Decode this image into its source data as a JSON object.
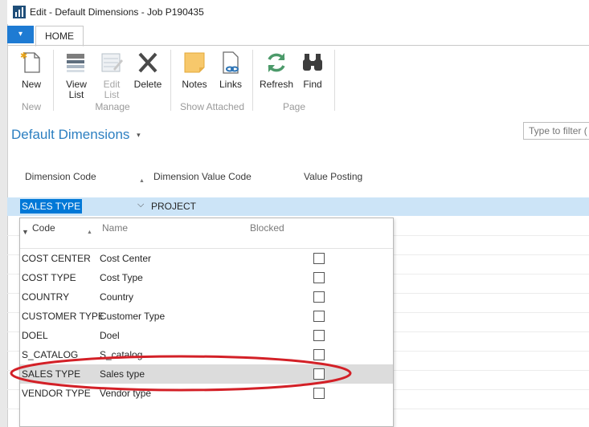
{
  "window": {
    "title": "Edit - Default Dimensions - Job P190435"
  },
  "ribbon": {
    "file_glyph": "▾",
    "tab_home": "HOME",
    "buttons": {
      "new": "New",
      "view_list_1": "View",
      "view_list_2": "List",
      "edit_list_1": "Edit",
      "edit_list_2": "List",
      "delete": "Delete",
      "notes": "Notes",
      "links": "Links",
      "refresh": "Refresh",
      "find": "Find"
    },
    "groups": {
      "new": "New",
      "manage": "Manage",
      "show_attached": "Show Attached",
      "page": "Page"
    }
  },
  "page": {
    "title": "Default Dimensions",
    "title_caret": "▾",
    "filter_placeholder": "Type to filter (",
    "columns": [
      "Dimension Code",
      "Dimension Value Code",
      "Value Posting"
    ]
  },
  "selected_row": {
    "dimension_code": "SALES TYPE",
    "dimension_value_code": "PROJECT"
  },
  "dropdown": {
    "headers": {
      "code": "Code",
      "name": "Name",
      "blocked": "Blocked"
    },
    "rows": [
      {
        "code": "COST CENTER",
        "name": "Cost Center",
        "blocked": false
      },
      {
        "code": "COST TYPE",
        "name": "Cost Type",
        "blocked": false
      },
      {
        "code": "COUNTRY",
        "name": "Country",
        "blocked": false
      },
      {
        "code": "CUSTOMER TYPE",
        "name": "Customer Type",
        "blocked": false
      },
      {
        "code": "DOEL",
        "name": "Doel",
        "blocked": false
      },
      {
        "code": "S_CATALOG",
        "name": "S_catalog",
        "blocked": false
      },
      {
        "code": "SALES TYPE",
        "name": "Sales type",
        "blocked": false,
        "highlighted": true
      },
      {
        "code": "VENDOR TYPE",
        "name": "Vendor type",
        "blocked": false
      }
    ]
  },
  "colors": {
    "accent": "#2c7fc1",
    "selection": "#0078d7",
    "row_highlight": "#cce4f7",
    "annotation": "#d32027"
  },
  "icons": [
    "app-icon",
    "new-icon",
    "view-list-icon",
    "edit-list-icon",
    "delete-icon",
    "notes-icon",
    "links-icon",
    "refresh-icon",
    "find-icon"
  ]
}
